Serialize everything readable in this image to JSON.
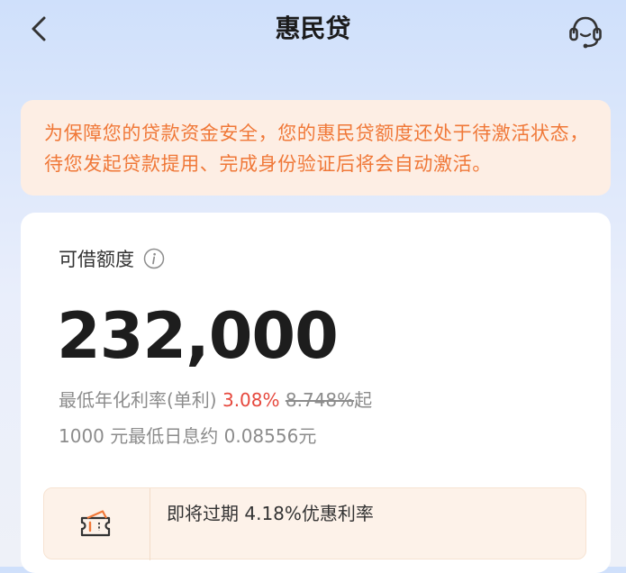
{
  "header": {
    "title": "惠民贷",
    "back_icon": "chevron-left-icon",
    "service_icon": "customer-service-headset-icon"
  },
  "notice": {
    "text": "为保障您的贷款资金安全，您的惠民贷额度还处于待激活状态，待您发起贷款提用、完成身份验证后将会自动激活。"
  },
  "card": {
    "limit_label": "可借额度",
    "info_icon": "info-icon",
    "amount": "232,000",
    "rate_prefix": "最低年化利率(单利) ",
    "rate_value": "3.08%",
    "rate_original": "8.748%",
    "rate_suffix": "起",
    "interest_text": "1000 元最低日息约 0.08556元"
  },
  "promo": {
    "icon": "ticket-coupon-icon",
    "text": "即将过期 4.18%优惠利率"
  },
  "colors": {
    "accent_orange": "#f07838",
    "highlight_red": "#e6483d",
    "notice_bg": "#fdeee4",
    "promo_bg": "#fdf2e9"
  }
}
